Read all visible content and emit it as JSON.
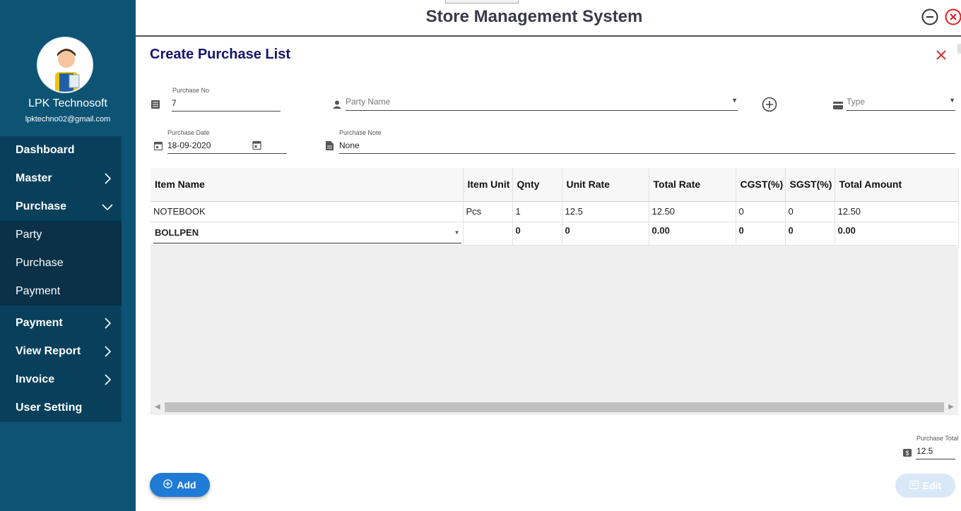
{
  "app": {
    "title": "Store Management System"
  },
  "sidebar": {
    "user_name": "LPK Technosoft",
    "user_email": "lpktechno02@gmail.com",
    "menu": [
      {
        "label": "Dashboard"
      },
      {
        "label": "Master"
      },
      {
        "label": "Purchase"
      }
    ],
    "submenu": [
      {
        "label": "Party"
      },
      {
        "label": "Purchase"
      },
      {
        "label": "Payment"
      }
    ],
    "menu2": [
      {
        "label": "Payment"
      },
      {
        "label": "View Report"
      },
      {
        "label": "Invoice"
      },
      {
        "label": "User Setting"
      }
    ]
  },
  "form": {
    "title": "Create Purchase List",
    "purchase_no": {
      "label": "Purchase No",
      "value": "7"
    },
    "party_name": {
      "placeholder": "Party Name"
    },
    "type": {
      "placeholder": "Type"
    },
    "purchase_date": {
      "label": "Purchase Date",
      "value": "18-09-2020"
    },
    "purchase_note": {
      "label": "Purchase Note",
      "value": "None"
    }
  },
  "grid": {
    "columns": [
      "Item Name",
      "Item Unit",
      "Qnty",
      "Unit Rate",
      "Total Rate",
      "CGST(%)",
      "SGST(%)",
      "Total Amount"
    ],
    "rows": [
      [
        "NOTEBOOK",
        "Pcs",
        "1",
        "12.5",
        "12.50",
        "0",
        "0",
        "12.50"
      ]
    ],
    "edit_row": [
      "BOLLPEN",
      "",
      "0",
      "0",
      "0.00",
      "0",
      "0",
      "0.00"
    ]
  },
  "footer": {
    "purchase_total_label": "Purchase Total",
    "purchase_total_value": "12.5",
    "add_label": "Add",
    "edit_label": "Edit"
  },
  "icons": [
    "minimize-icon",
    "close-window-icon",
    "close-icon",
    "list-icon",
    "person-icon",
    "add-circle-icon",
    "card-icon",
    "calendar-icon",
    "note-icon",
    "dollar-icon"
  ],
  "colors": {
    "sidebar": "#0c5374",
    "menu": "#08405c",
    "submenu": "#0a3148",
    "title": "#14146e",
    "accent": "#1f7bd6",
    "close": "#d32f2f"
  }
}
